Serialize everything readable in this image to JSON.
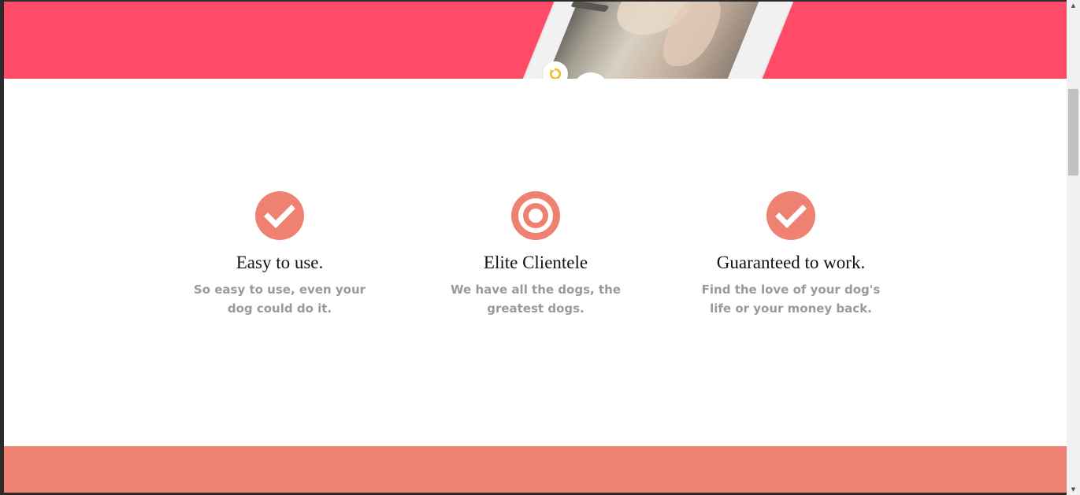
{
  "hero": {
    "band_color": "#ff4a68",
    "replay_icon": "replay-icon",
    "replay_color": "#f5b921"
  },
  "features": {
    "accent_color": "#ef8172",
    "items": [
      {
        "icon": "check-circle-icon",
        "title": "Easy to use.",
        "description": "So easy to use, even your dog could do it."
      },
      {
        "icon": "target-icon",
        "title": "Elite Clientele",
        "description": "We have all the dogs, the greatest dogs."
      },
      {
        "icon": "check-circle-icon",
        "title": "Guaranteed to work.",
        "description": "Find the love of your dog's life or your money back."
      }
    ]
  },
  "bottom_band": {
    "color": "#ef8172"
  },
  "scrollbar": {
    "up_arrow": "▲",
    "down_arrow": "▼"
  }
}
